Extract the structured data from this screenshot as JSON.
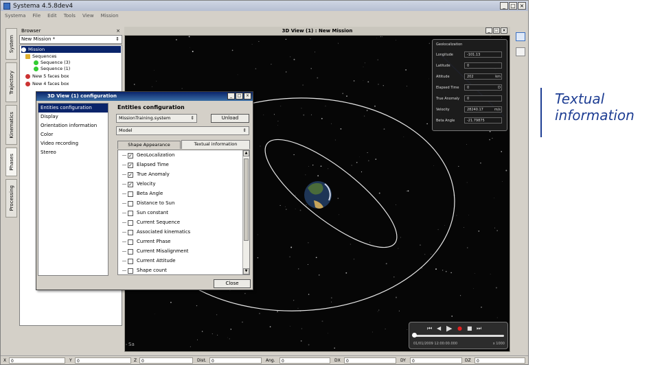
{
  "window": {
    "title": "Systema 4.5.8dev4",
    "min": "_",
    "max": "□",
    "close": "×"
  },
  "menu": [
    "Systema",
    "File",
    "Edit",
    "Tools",
    "View",
    "Mission"
  ],
  "vertical_tabs": [
    "System",
    "Trajectory",
    "Kinematics",
    "Phases",
    "Processing"
  ],
  "browser": {
    "title": "Browser",
    "close": "×",
    "selected": "New Mission *",
    "arrow": "⇕",
    "tree": [
      {
        "label": "Mission",
        "color": "#ffffff"
      },
      {
        "label": "Sequences",
        "color": "#e0b030"
      },
      {
        "label": "Sequence (3)",
        "color": "#33cc33"
      },
      {
        "label": "Sequence (1)",
        "color": "#33cc33"
      },
      {
        "label": "New 5 faces box",
        "color": "#cc3333"
      },
      {
        "label": "New 4 faces box",
        "color": "#cc3333"
      }
    ]
  },
  "view": {
    "title": "3D View (1) : New Mission",
    "logo": "Sa",
    "info": {
      "title": "Geolocalization",
      "rows": [
        {
          "label": "Longitude",
          "value": "-101.13",
          "unit": ""
        },
        {
          "label": "Latitude",
          "value": "0",
          "unit": ""
        },
        {
          "label": "Altitude",
          "value": "202",
          "unit": "km"
        },
        {
          "label": "Elapsed Time",
          "value": "0",
          "unit": "D"
        },
        {
          "label": "True Anomaly",
          "value": "0",
          "unit": ""
        },
        {
          "label": "Velocity",
          "value": "28240.17",
          "unit": "m/s"
        },
        {
          "label": "Beta Angle",
          "value": "-21.79875",
          "unit": ""
        }
      ]
    },
    "player": {
      "controls": [
        "⏮",
        "◀",
        "▶",
        "●",
        "■",
        "⏭"
      ],
      "time": "01/01/2009 12:00:00.000",
      "speed": "x 1000"
    }
  },
  "dialog": {
    "title": "3D View (1) configuration",
    "min": "_",
    "max": "□",
    "close": "×",
    "list": [
      "Entities configuration",
      "Display",
      "Orientation information",
      "Color",
      "Video recording",
      "Stereo"
    ],
    "heading": "Entities configuration",
    "entity_combo": "MissionTraining.system",
    "unload": "Unload",
    "model_combo": "Model",
    "combo_arrow": "⇕",
    "tabs": [
      "Shape Appearance",
      "Textual information"
    ],
    "checks": [
      {
        "label": "GeoLocalization",
        "checked": true
      },
      {
        "label": "Elapsed Time",
        "checked": true
      },
      {
        "label": "True Anomaly",
        "checked": true
      },
      {
        "label": "Velocity",
        "checked": true
      },
      {
        "label": "Beta Angle",
        "checked": false
      },
      {
        "label": "Distance to Sun",
        "checked": false
      },
      {
        "label": "Sun constant",
        "checked": false
      },
      {
        "label": "Current Sequence",
        "checked": false
      },
      {
        "label": "Associated kinematics",
        "checked": false
      },
      {
        "label": "Current Phase",
        "checked": false
      },
      {
        "label": "Current Misalignment",
        "checked": false
      },
      {
        "label": "Current Attitude",
        "checked": false
      },
      {
        "label": "Shape count",
        "checked": false
      }
    ],
    "close_btn": "Close"
  },
  "statusbar": [
    {
      "label": "X",
      "value": "0"
    },
    {
      "label": "Y",
      "value": "0"
    },
    {
      "label": "Z",
      "value": "0"
    },
    {
      "label": "Dist.",
      "value": "0"
    },
    {
      "label": "Ang.",
      "value": "0"
    },
    {
      "label": "DX",
      "value": "0"
    },
    {
      "label": "DY",
      "value": "0"
    },
    {
      "label": "DZ",
      "value": "0"
    }
  ],
  "callout": {
    "line1": "Textual",
    "line2": "information"
  }
}
